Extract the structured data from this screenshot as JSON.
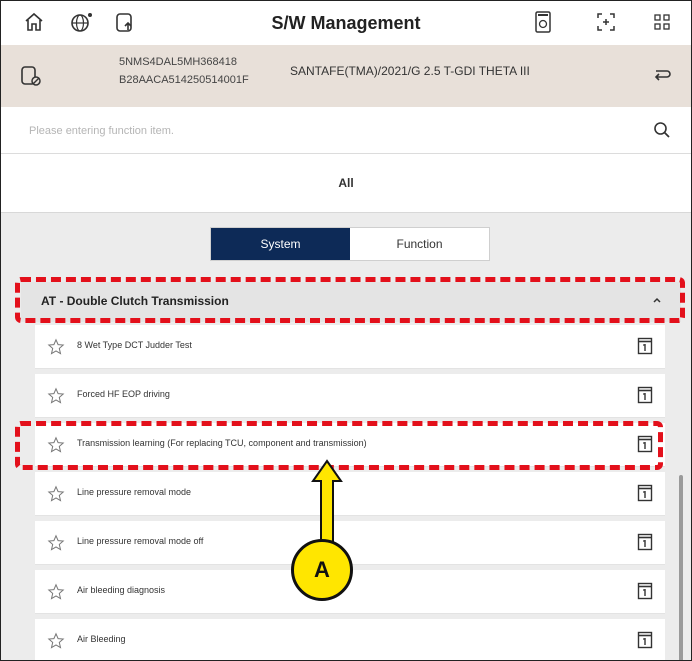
{
  "header": {
    "title": "S/W Management",
    "icons": [
      "home-icon",
      "globe-settings-icon",
      "vehicle-upload-icon",
      "calculator-icon",
      "screen-capture-icon",
      "grid-menu-icon"
    ]
  },
  "vehicle": {
    "vin": "5NMS4DAL5MH368418",
    "ecu_code": "B28AACA514250514001F",
    "model": "SANTAFE(TMA)/2021/G 2.5 T-GDI THETA III"
  },
  "search": {
    "placeholder": "Please entering function item."
  },
  "tabs": {
    "all_label": "All"
  },
  "segment": {
    "system_label": "System",
    "function_label": "Function",
    "selected": "System"
  },
  "section": {
    "title": "AT - Double Clutch Transmission"
  },
  "items": [
    {
      "label": "8 Wet Type DCT Judder Test"
    },
    {
      "label": "Forced HF EOP driving"
    },
    {
      "label": "Transmission learning (For replacing TCU, component and transmission)"
    },
    {
      "label": "Line pressure removal mode"
    },
    {
      "label": "Line pressure removal mode off"
    },
    {
      "label": "Air bleeding diagnosis"
    },
    {
      "label": "Air Bleeding"
    }
  ],
  "annotation": {
    "callout_label": "A"
  },
  "colors": {
    "segment_active": "#0d2a57",
    "annotation_red": "#e3101b",
    "callout_yellow": "#ffe600"
  }
}
